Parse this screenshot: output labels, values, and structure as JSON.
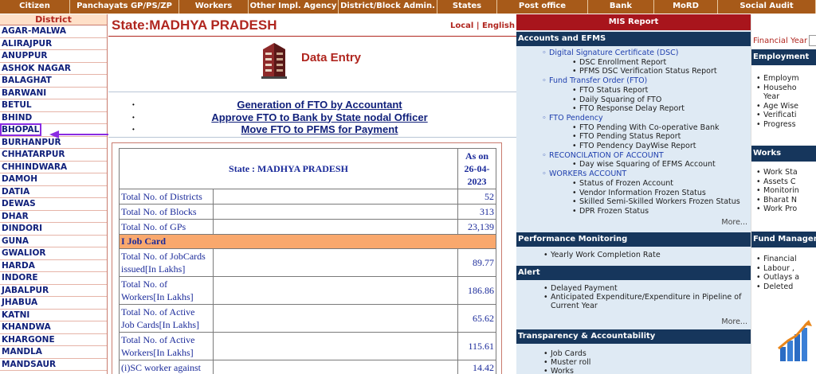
{
  "topnav": [
    {
      "label": "Citizen",
      "w": 88
    },
    {
      "label": "Panchayats GP/PS/ZP",
      "w": 137
    },
    {
      "label": "Workers",
      "w": 87
    },
    {
      "label": "Other Impl. Agency",
      "w": 113
    },
    {
      "label": "District/Block Admin.",
      "w": 124
    },
    {
      "label": "States",
      "w": 75
    },
    {
      "label": "Post office",
      "w": 114
    },
    {
      "label": "Bank",
      "w": 83
    },
    {
      "label": "MoRD",
      "w": 80
    },
    {
      "label": "Social Audit",
      "w": 123
    }
  ],
  "district": {
    "heading": "District",
    "items": [
      "AGAR-MALWA",
      "ALIRAJPUR",
      "ANUPPUR",
      "ASHOK NAGAR",
      "BALAGHAT",
      "BARWANI",
      "BETUL",
      "BHIND",
      "BHOPAL",
      "BURHANPUR",
      "CHHATARPUR",
      "CHHINDWARA",
      "DAMOH",
      "DATIA",
      "DEWAS",
      "DHAR",
      "DINDORI",
      "GUNA",
      "GWALIOR",
      "HARDA",
      "INDORE",
      "JABALPUR",
      "JHABUA",
      "KATNI",
      "KHANDWA",
      "KHARGONE",
      "MANDLA",
      "MANDSAUR"
    ],
    "selected": "BHOPAL"
  },
  "state": {
    "title": "State:MADHYA PRADESH",
    "lang_local": "Local",
    "lang_sep": "|",
    "lang_english": "English",
    "data_entry": "Data Entry"
  },
  "fto_links": [
    "Generation of FTO by Accountant",
    "Approve FTO to Bank by State nodal Officer",
    "Move FTO to PFMS for Payment"
  ],
  "stats": {
    "header_state": "State : MADHYA PRADESH",
    "header_date_1": "As on",
    "header_date_2": "26-04-",
    "header_date_3": "2023",
    "rows_top": [
      {
        "label": "Total No. of Districts",
        "value": "52"
      },
      {
        "label": "Total No. of Blocks",
        "value": "313"
      },
      {
        "label": "Total No. of GPs",
        "value": "23,139"
      }
    ],
    "section": "I Job Card",
    "rows_jc": [
      {
        "l1": "Total No. of JobCards",
        "l2": "issued[In Lakhs]",
        "value": "89.77"
      },
      {
        "l1": "Total No. of",
        "l2": "Workers[In Lakhs]",
        "value": "186.86"
      },
      {
        "l1": "Total No. of Active",
        "l2": "Job Cards[In Lakhs]",
        "value": "65.62"
      },
      {
        "l1": "Total No. of Active",
        "l2": "Workers[In Lakhs]",
        "value": "115.61"
      },
      {
        "l1": "(i)SC worker against",
        "l2": "",
        "value": "14.42"
      }
    ]
  },
  "mis": {
    "title": "MIS Report",
    "sections": {
      "accounts": "Accounts and EFMS",
      "performance": "Performance Monitoring",
      "alert": "Alert",
      "transparency": "Transparency & Accountability"
    },
    "accounts_rows": [
      {
        "lvl": 1,
        "text": "Digital Signature Certificate (DSC)"
      },
      {
        "lvl": 2,
        "text": "DSC Enrollment Report"
      },
      {
        "lvl": 2,
        "text": "PFMS DSC Verification Status Report"
      },
      {
        "lvl": 1,
        "text": "Fund Transfer Order (FTO)"
      },
      {
        "lvl": 2,
        "text": "FTO Status Report"
      },
      {
        "lvl": 2,
        "text": "Daily Squaring of FTO"
      },
      {
        "lvl": 2,
        "text": "FTO Response Delay Report"
      },
      {
        "lvl": 1,
        "text": "FTO Pendency"
      },
      {
        "lvl": 2,
        "text": "FTO Pending With Co-operative Bank"
      },
      {
        "lvl": 2,
        "text": "FTO Pending Status Report"
      },
      {
        "lvl": 2,
        "text": "FTO Pendency DayWise Report"
      },
      {
        "lvl": 1,
        "text": "RECONCILATION OF ACCOUNT"
      },
      {
        "lvl": 2,
        "text": "Day wise Squaring of EFMS Account"
      },
      {
        "lvl": 1,
        "text": "WORKERs ACCOUNT"
      },
      {
        "lvl": 2,
        "text": "Status of Frozen Account"
      },
      {
        "lvl": 2,
        "text": "Vendor Information Frozen Status"
      },
      {
        "lvl": 2,
        "text": "Skilled Semi-Skilled Workers Frozen Status"
      },
      {
        "lvl": 2,
        "text": "DPR Frozen Status"
      }
    ],
    "more_1": "More...",
    "performance_rows": [
      "Yearly Work Completion Rate"
    ],
    "alert_rows": [
      "Delayed Payment",
      "Anticipated Expenditure/Expenditure in Pipeline of",
      "Current Year"
    ],
    "more_2": "More...",
    "transparency_rows": [
      "Job Cards",
      "Muster roll",
      "Works"
    ]
  },
  "right": {
    "fy_label": "Financial Year",
    "sections": {
      "employment": "Employment",
      "works": "Works",
      "fund": "Fund Management"
    },
    "employment_rows": [
      {
        "text": "Employm",
        "bullet": true
      },
      {
        "text": "Househo",
        "bullet": true
      },
      {
        "text": "Year",
        "bullet": false
      },
      {
        "text": "Age Wise",
        "bullet": true
      },
      {
        "text": "Verificati",
        "bullet": true
      },
      {
        "text": "Progress",
        "bullet": true
      }
    ],
    "works_rows": [
      "Work Sta",
      "Assets C",
      "Monitorin",
      "Bharat N",
      "Work Pro"
    ],
    "fund_rows": [
      "Financial",
      "Labour ,",
      "Outlays a",
      "Deleted"
    ]
  },
  "colors": {
    "nav_bg": "#a75a19",
    "accent_red": "#b0261f",
    "link_blue": "#0f1f7a",
    "mis_header": "#16365c",
    "mis_bg": "#dfeaf4",
    "section_orange": "#f9a86d",
    "highlight_purple": "#8a2be2"
  }
}
